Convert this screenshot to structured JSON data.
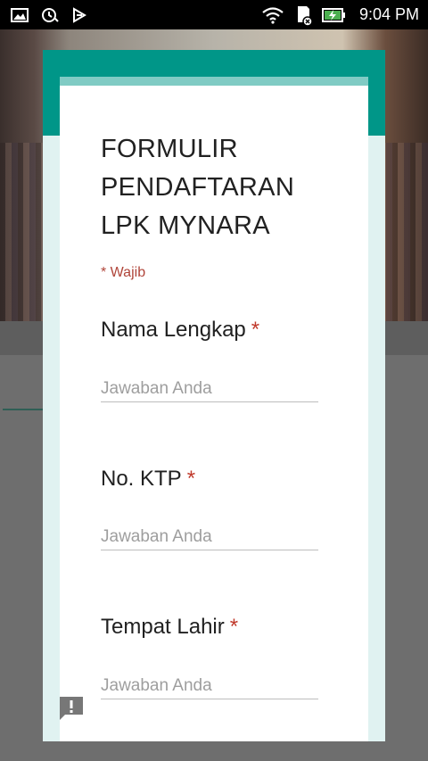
{
  "status_bar": {
    "time": "9:04 PM",
    "left_icons": [
      "gallery-icon",
      "sync-icon",
      "download-icon"
    ],
    "right_icons": [
      "wifi-icon",
      "sd-card-icon",
      "battery-charging-icon"
    ]
  },
  "form": {
    "title": "FORMULIR PENDAFTARAN LPK MYNARA",
    "required_note": "* Wajib",
    "questions": [
      {
        "label": "Nama Lengkap",
        "required_mark": "*",
        "placeholder": "Jawaban Anda"
      },
      {
        "label": "No. KTP",
        "required_mark": "*",
        "placeholder": "Jawaban Anda"
      },
      {
        "label": "Tempat Lahir",
        "required_mark": "*",
        "placeholder": "Jawaban Anda"
      }
    ]
  },
  "colors": {
    "header": "#009688",
    "accent_stripe": "#80cbc4",
    "dialog_background": "#e0f2f1",
    "required": "#c0392b"
  },
  "icons": {
    "feedback": "report-feedback-icon"
  }
}
